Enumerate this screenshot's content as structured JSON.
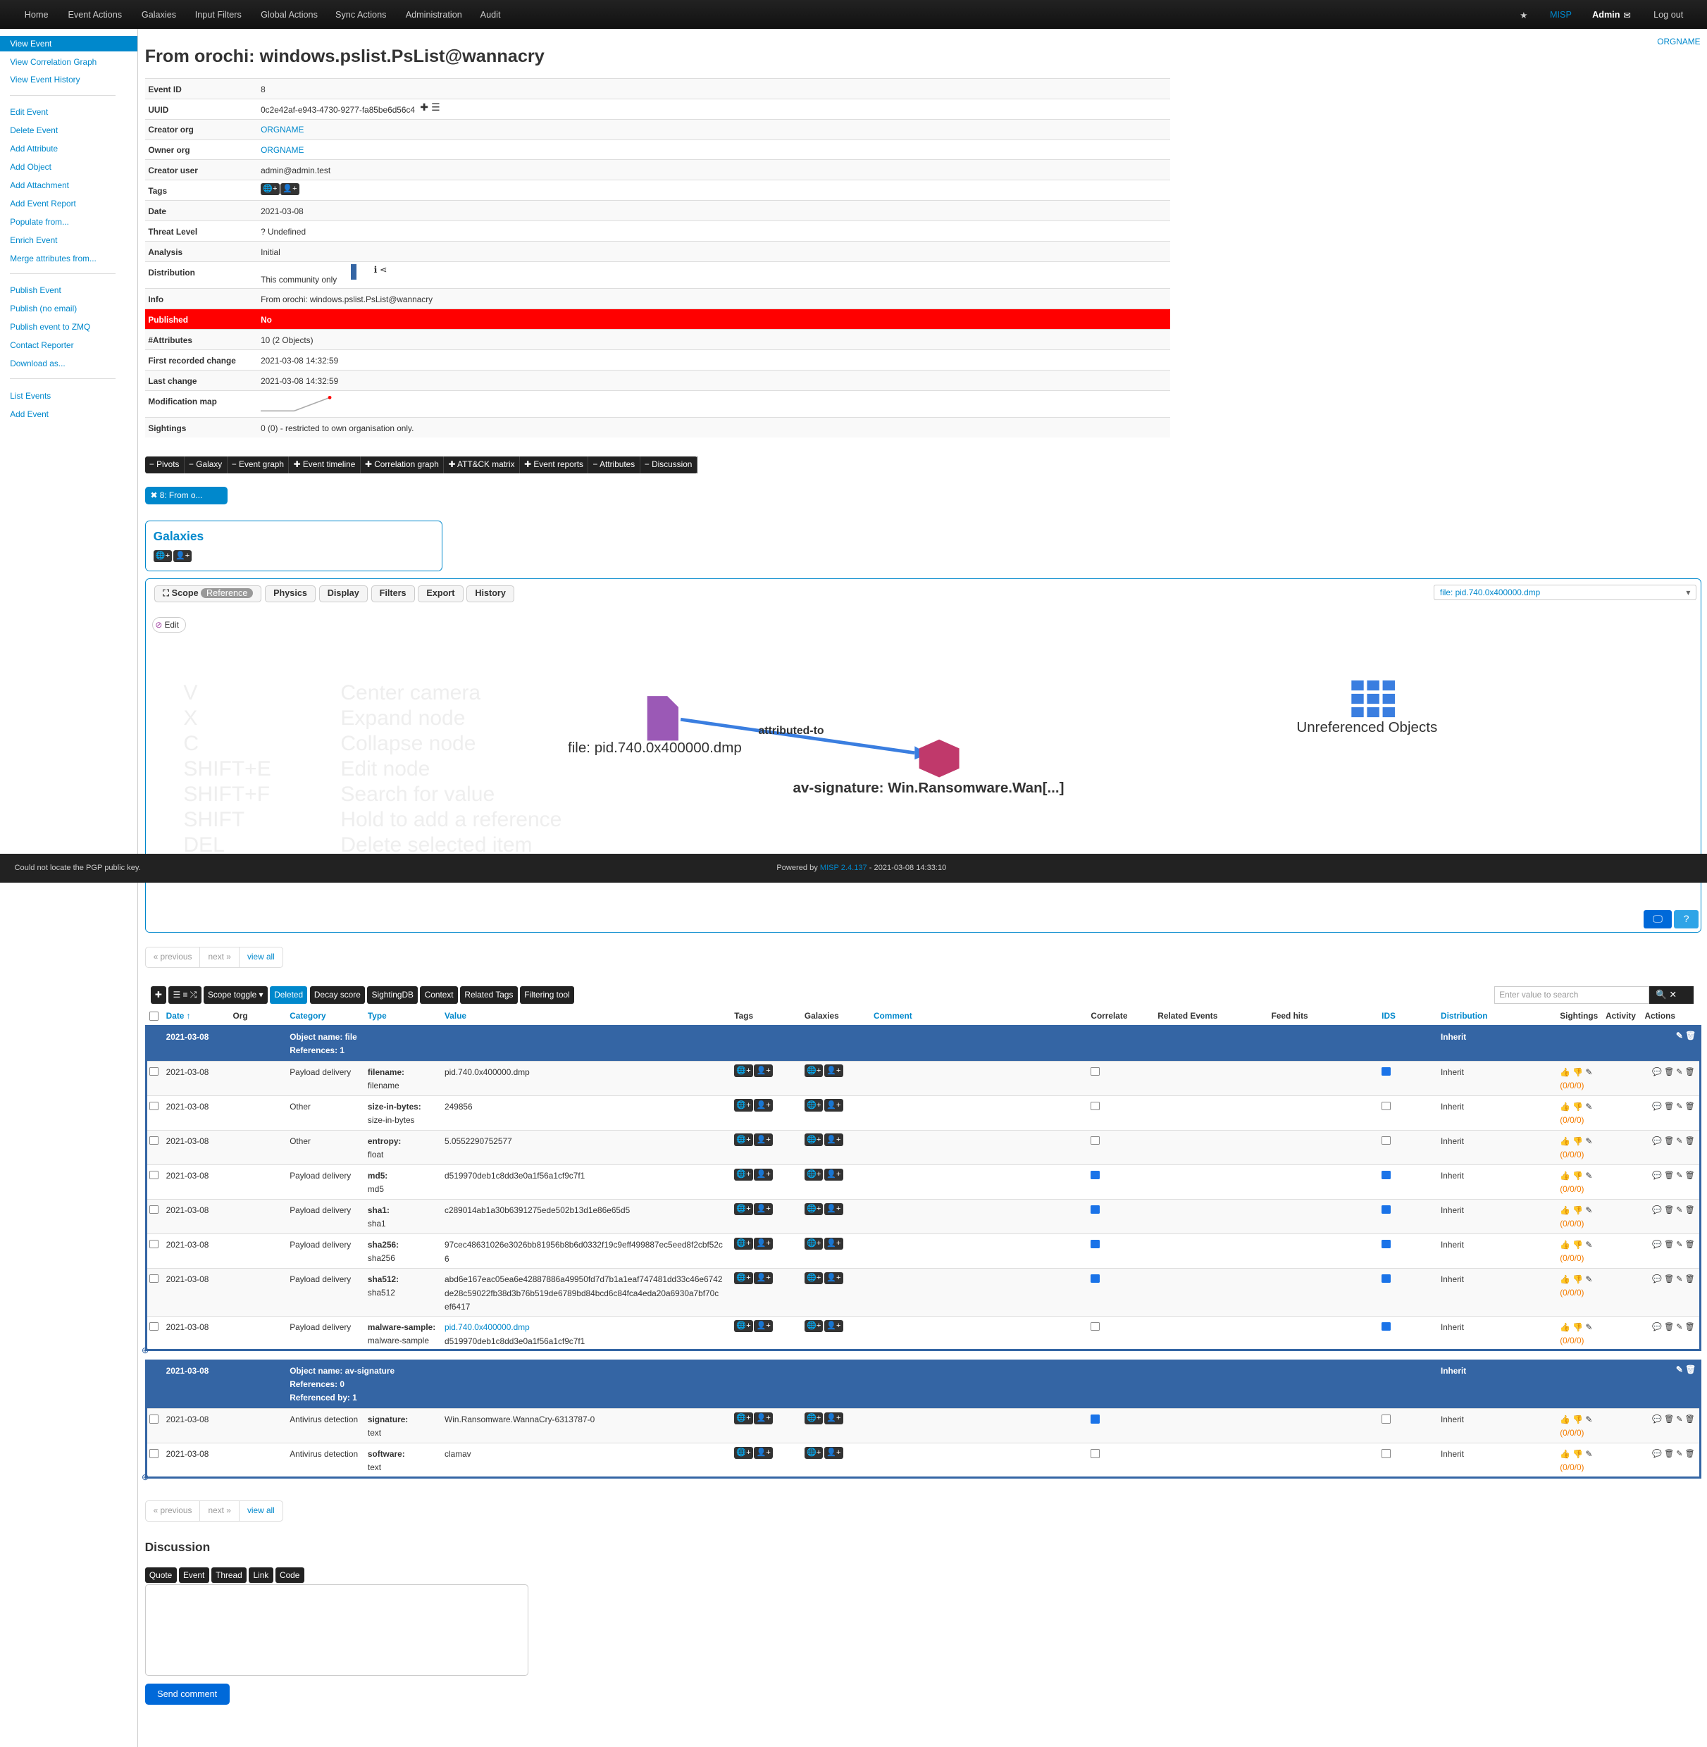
{
  "nav": {
    "items": [
      "Home",
      "Event Actions",
      "Galaxies",
      "Input Filters",
      "Global Actions",
      "Sync Actions",
      "Administration",
      "Audit"
    ],
    "brand": "MISP",
    "user": "Admin",
    "logout": "Log out",
    "org": "ORGNAME"
  },
  "sidebar": {
    "groups": [
      [
        "View Event",
        "View Correlation Graph",
        "View Event History"
      ],
      [
        "Edit Event",
        "Delete Event",
        "Add Attribute",
        "Add Object",
        "Add Attachment",
        "Add Event Report",
        "Populate from...",
        "Enrich Event",
        "Merge attributes from..."
      ],
      [
        "Publish Event",
        "Publish (no email)",
        "Publish event to ZMQ",
        "Contact Reporter",
        "Download as..."
      ],
      [
        "List Events",
        "Add Event"
      ]
    ]
  },
  "event": {
    "title": "From orochi: windows.pslist.PsList@wannacry",
    "fields": [
      {
        "k": "Event ID",
        "v": "8"
      },
      {
        "k": "UUID",
        "v": "0c2e42af-e943-4730-9277-fa85be6d56c4"
      },
      {
        "k": "Creator org",
        "v": "ORGNAME",
        "link": true
      },
      {
        "k": "Owner org",
        "v": "ORGNAME",
        "link": true
      },
      {
        "k": "Creator user",
        "v": "admin@admin.test"
      },
      {
        "k": "Tags",
        "v": ""
      },
      {
        "k": "Date",
        "v": "2021-03-08"
      },
      {
        "k": "Threat Level",
        "v": "? Undefined"
      },
      {
        "k": "Analysis",
        "v": "Initial"
      },
      {
        "k": "Distribution",
        "v": "This community only"
      },
      {
        "k": "Info",
        "v": "From orochi: windows.pslist.PsList@wannacry"
      },
      {
        "k": "Published",
        "v": "No",
        "red": true
      },
      {
        "k": "#Attributes",
        "v": "10 (2 Objects)"
      },
      {
        "k": "First recorded change",
        "v": "2021-03-08 14:32:59"
      },
      {
        "k": "Last change",
        "v": "2021-03-08 14:32:59"
      },
      {
        "k": "Modification map",
        "v": ""
      },
      {
        "k": "Sightings",
        "v": "0 (0) - restricted to own organisation only."
      }
    ]
  },
  "buttons": [
    "− Pivots",
    "− Galaxy",
    "− Event graph",
    "✚ Event timeline",
    "✚ Correlation graph",
    "✚ ATT&CK matrix",
    "✚ Event reports",
    "− Attributes",
    "− Discussion"
  ],
  "pivot": "✖ 8: From o...",
  "galaxies": {
    "title": "Galaxies"
  },
  "graph": {
    "scope": "Scope",
    "reference": "Reference",
    "physics": "Physics",
    "display": "Display",
    "filters": "Filters",
    "export": "Export",
    "history": "History",
    "select": "file: pid.740.0x400000.dmp",
    "edit": "Edit",
    "hints": [
      [
        "V",
        "Center camera"
      ],
      [
        "X",
        "Expand node"
      ],
      [
        "C",
        "Collapse node"
      ],
      [
        "SHIFT+E",
        "Edit node"
      ],
      [
        "SHIFT+F",
        "Search for value"
      ],
      [
        "SHIFT",
        "Hold to add a reference"
      ],
      [
        "DEL",
        "Delete selected item"
      ]
    ],
    "node_file": "file: pid.740.0x400000.dmp",
    "edge": "attributed-to",
    "node_av": "av-signature: Win.Ransomware.Wan[...]",
    "unref": "Unreferenced Objects"
  },
  "footer": {
    "left": "Could not locate the PGP public key.",
    "powered": "Powered by",
    "misp": "MISP 2.4.137",
    "time": "- 2021-03-08 14:33:10"
  },
  "pagination": {
    "prev": "« previous",
    "next": "next »",
    "all": "view all"
  },
  "toolbar": {
    "items": [
      "Scope toggle ▾",
      "Deleted",
      "Decay score",
      "SightingDB",
      "Context",
      "Related Tags",
      "Filtering tool"
    ],
    "search_placeholder": "Enter value to search"
  },
  "columns": [
    "Date ↑",
    "Org",
    "Category",
    "Type",
    "Value",
    "Tags",
    "Galaxies",
    "Comment",
    "Correlate",
    "Related Events",
    "Feed hits",
    "IDS",
    "Distribution",
    "Sightings",
    "Activity",
    "Actions"
  ],
  "objects": [
    {
      "date": "2021-03-08",
      "name": "Object name: file",
      "lines": [
        "References: 1"
      ],
      "dist": "Inherit",
      "rows": [
        {
          "date": "2021-03-08",
          "cat": "Payload delivery",
          "type": "filename:",
          "sub": "filename",
          "value": [
            "pid.740.0x400000.dmp"
          ],
          "corr": false,
          "ids": true
        },
        {
          "date": "2021-03-08",
          "cat": "Other",
          "type": "size-in-bytes:",
          "sub": "size-in-bytes",
          "value": [
            "249856"
          ],
          "corr": false,
          "ids": false
        },
        {
          "date": "2021-03-08",
          "cat": "Other",
          "type": "entropy:",
          "sub": "float",
          "value": [
            "5.0552290752577"
          ],
          "corr": false,
          "ids": false
        },
        {
          "date": "2021-03-08",
          "cat": "Payload delivery",
          "type": "md5:",
          "sub": "md5",
          "value": [
            "d519970deb1c8dd3e0a1f56a1cf9c7f1"
          ],
          "corr": true,
          "ids": true
        },
        {
          "date": "2021-03-08",
          "cat": "Payload delivery",
          "type": "sha1:",
          "sub": "sha1",
          "value": [
            "c289014ab1a30b6391275ede502b13d1e86e65d5"
          ],
          "corr": true,
          "ids": true
        },
        {
          "date": "2021-03-08",
          "cat": "Payload delivery",
          "type": "sha256:",
          "sub": "sha256",
          "value": [
            "97cec48631026e3026bb81956b8b6d0332f19c9eff499887ec5eed8f2cbf52c",
            "6"
          ],
          "corr": true,
          "ids": true
        },
        {
          "date": "2021-03-08",
          "cat": "Payload delivery",
          "type": "sha512:",
          "sub": "sha512",
          "value": [
            "abd6e167eac05ea6e42887886a49950fd7d7b1a1eaf747481dd33c46e6742",
            "de28c59022fb38d3b76b519de6789bd84bcd6c84fca4eda20a6930a7bf70c",
            "ef6417"
          ],
          "corr": true,
          "ids": true
        },
        {
          "date": "2021-03-08",
          "cat": "Payload delivery",
          "type": "malware-sample:",
          "sub": "malware-sample",
          "value": [
            "pid.740.0x400000.dmp",
            "d519970deb1c8dd3e0a1f56a1cf9c7f1"
          ],
          "corr": false,
          "ids": true,
          "firstlink": true
        }
      ]
    },
    {
      "date": "2021-03-08",
      "name": "Object name: av-signature",
      "lines": [
        "References: 0",
        "Referenced by: 1"
      ],
      "dist": "Inherit",
      "rows": [
        {
          "date": "2021-03-08",
          "cat": "Antivirus detection",
          "type": "signature:",
          "sub": "text",
          "value": [
            "Win.Ransomware.WannaCry-6313787-0"
          ],
          "corr": true,
          "ids": false
        },
        {
          "date": "2021-03-08",
          "cat": "Antivirus detection",
          "type": "software:",
          "sub": "text",
          "value": [
            "clamav"
          ],
          "corr": false,
          "ids": false
        }
      ]
    }
  ],
  "row_dist": "Inherit",
  "sightings_count": "(0/0/0)",
  "discussion": {
    "title": "Discussion",
    "tools": [
      "Quote",
      "Event",
      "Thread",
      "Link",
      "Code"
    ],
    "send": "Send comment"
  },
  "colors": {
    "accent": "#0088cc",
    "object_header": "#3465a4",
    "published_no": "#ff0000",
    "navbar": "#1a1a1a"
  }
}
